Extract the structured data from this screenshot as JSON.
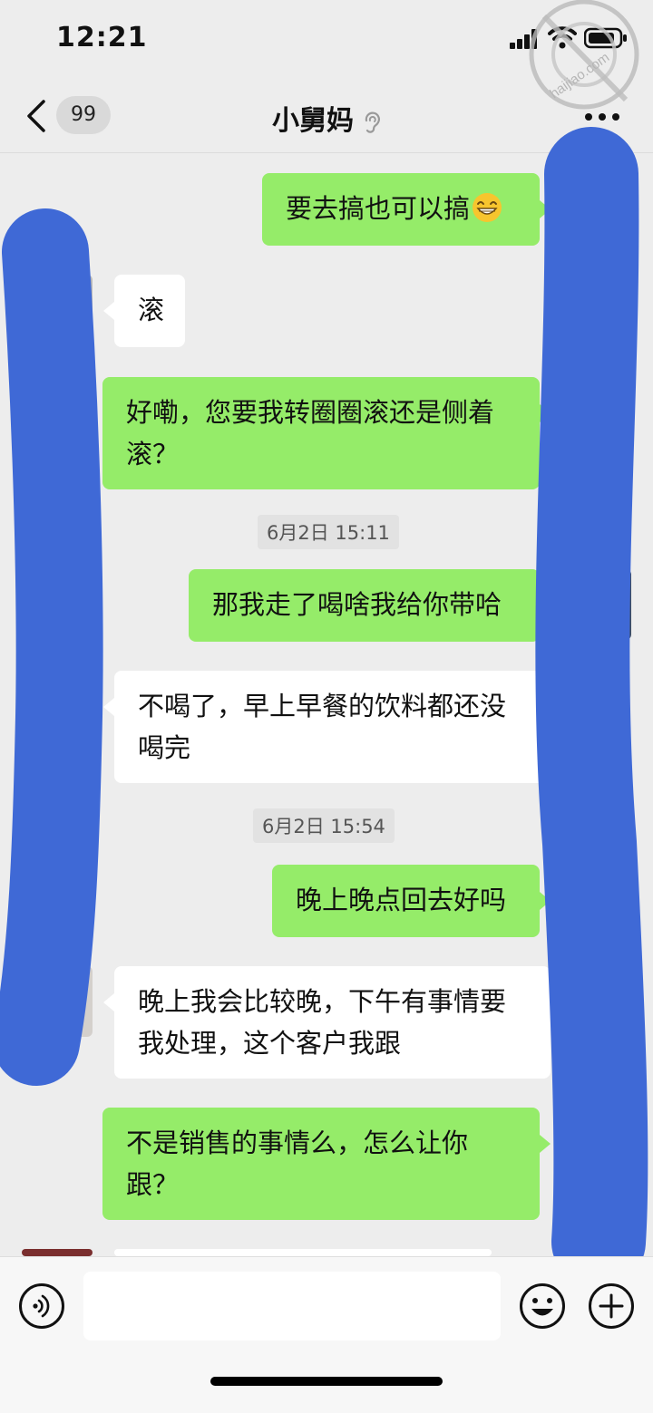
{
  "status_bar": {
    "time": "12:21"
  },
  "watermark": {
    "text": "haijiao.com"
  },
  "nav": {
    "back_count": "99",
    "title": "小舅妈"
  },
  "messages": [
    {
      "side": "out",
      "text": "要去搞也可以搞",
      "emoji": "grin-emoji"
    },
    {
      "side": "in",
      "text": "滚"
    },
    {
      "side": "out",
      "text": "好嘞，您要我转圈圈滚还是侧着滚？"
    },
    {
      "side": "time",
      "text": "6月2日 15:11"
    },
    {
      "side": "out",
      "text": "那我走了喝啥我给你带哈"
    },
    {
      "side": "in",
      "text": "不喝了，早上早餐的饮料都还没喝完"
    },
    {
      "side": "time",
      "text": "6月2日 15:54"
    },
    {
      "side": "out",
      "text": "晚上晚点回去好吗"
    },
    {
      "side": "in",
      "text": "晚上我会比较晚，下午有事情要我处理，这个客户我跟"
    },
    {
      "side": "out",
      "text": "不是销售的事情么，怎么让你跟？"
    }
  ],
  "input_bar": {
    "voice_icon": "voice-icon",
    "emoji_icon": "emoji-icon",
    "plus_icon": "plus-icon"
  },
  "colors": {
    "background": "#ededed",
    "outgoing_bubble": "#95ec69",
    "incoming_bubble": "#ffffff",
    "redaction_scribble": "#3f69d6"
  }
}
